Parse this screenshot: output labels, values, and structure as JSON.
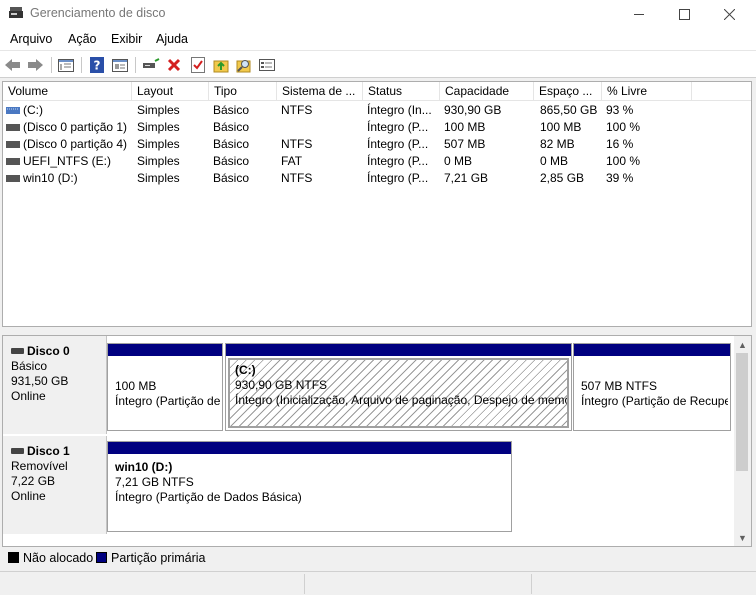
{
  "window": {
    "title": "Gerenciamento de disco"
  },
  "menu": [
    "Arquivo",
    "Ação",
    "Exibir",
    "Ajuda"
  ],
  "columns": [
    "Volume",
    "Layout",
    "Tipo",
    "Sistema de ...",
    "Status",
    "Capacidade",
    "Espaço ...",
    "% Livre"
  ],
  "volumes": [
    {
      "volume": "(C:)",
      "layout": "Simples",
      "tipo": "Básico",
      "fs": "NTFS",
      "status": "Íntegro (In...",
      "capacidade": "930,90 GB",
      "espaco": "865,50 GB",
      "livre": "93 %"
    },
    {
      "volume": "(Disco 0 partição 1)",
      "layout": "Simples",
      "tipo": "Básico",
      "fs": "",
      "status": "Íntegro (P...",
      "capacidade": "100 MB",
      "espaco": "100 MB",
      "livre": "100 %"
    },
    {
      "volume": "(Disco 0 partição 4)",
      "layout": "Simples",
      "tipo": "Básico",
      "fs": "NTFS",
      "status": "Íntegro (P...",
      "capacidade": "507 MB",
      "espaco": "82 MB",
      "livre": "16 %"
    },
    {
      "volume": "UEFI_NTFS (E:)",
      "layout": "Simples",
      "tipo": "Básico",
      "fs": "FAT",
      "status": "Íntegro (P...",
      "capacidade": "0 MB",
      "espaco": "0 MB",
      "livre": "100 %"
    },
    {
      "volume": "win10 (D:)",
      "layout": "Simples",
      "tipo": "Básico",
      "fs": "NTFS",
      "status": "Íntegro (P...",
      "capacidade": "7,21 GB",
      "espaco": "2,85 GB",
      "livre": "39 %"
    }
  ],
  "disks": [
    {
      "name": "Disco 0",
      "type": "Básico",
      "size": "931,50 GB",
      "state": "Online",
      "partitions": [
        {
          "title": "",
          "size": "100 MB",
          "status": "Íntegro (Partição de"
        },
        {
          "title": "(C:)",
          "size": "930,90 GB NTFS",
          "status": "Íntegro (Inicialização, Arquivo de paginação, Despejo de memó"
        },
        {
          "title": "",
          "size": "507 MB NTFS",
          "status": "Íntegro (Partição de Recupe"
        }
      ]
    },
    {
      "name": "Disco 1",
      "type": "Removível",
      "size": "7,22 GB",
      "state": "Online",
      "partitions": [
        {
          "title": "win10  (D:)",
          "size": "7,21 GB NTFS",
          "status": "Íntegro (Partição de Dados Básica)"
        }
      ]
    }
  ],
  "legend": [
    {
      "label": "Não alocado",
      "color": "#000000"
    },
    {
      "label": "Partição primária",
      "color": "#000080"
    }
  ],
  "toolbar_icons": [
    "back-icon",
    "forward-icon",
    "properties-icon",
    "help-icon",
    "console-icon",
    "connect-icon",
    "delete-icon",
    "checklist-icon",
    "upload-icon",
    "search-icon",
    "details-icon"
  ]
}
